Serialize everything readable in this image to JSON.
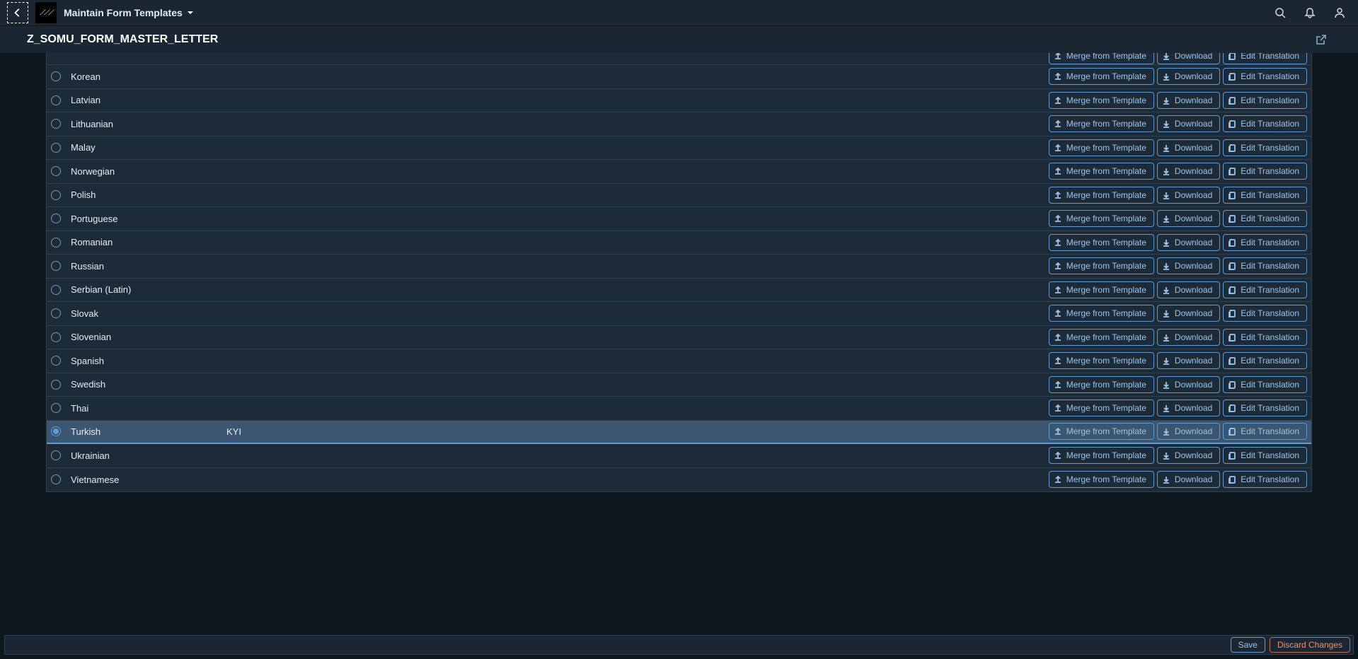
{
  "shell": {
    "app_title": "Maintain Form Templates"
  },
  "page": {
    "title": "Z_SOMU_FORM_MASTER_LETTER"
  },
  "buttons": {
    "merge": "Merge from Template",
    "download": "Download",
    "edit": "Edit Translation",
    "save": "Save",
    "discard": "Discard Changes"
  },
  "rows": [
    {
      "id": "partial-top",
      "name": "",
      "desc": "",
      "selected": false,
      "partial": true
    },
    {
      "id": "korean",
      "name": "Korean",
      "desc": "",
      "selected": false
    },
    {
      "id": "latvian",
      "name": "Latvian",
      "desc": "",
      "selected": false
    },
    {
      "id": "lithuanian",
      "name": "Lithuanian",
      "desc": "",
      "selected": false
    },
    {
      "id": "malay",
      "name": "Malay",
      "desc": "",
      "selected": false
    },
    {
      "id": "norwegian",
      "name": "Norwegian",
      "desc": "",
      "selected": false
    },
    {
      "id": "polish",
      "name": "Polish",
      "desc": "",
      "selected": false
    },
    {
      "id": "portuguese",
      "name": "Portuguese",
      "desc": "",
      "selected": false
    },
    {
      "id": "romanian",
      "name": "Romanian",
      "desc": "",
      "selected": false
    },
    {
      "id": "russian",
      "name": "Russian",
      "desc": "",
      "selected": false
    },
    {
      "id": "serbian",
      "name": "Serbian (Latin)",
      "desc": "",
      "selected": false
    },
    {
      "id": "slovak",
      "name": "Slovak",
      "desc": "",
      "selected": false
    },
    {
      "id": "slovenian",
      "name": "Slovenian",
      "desc": "",
      "selected": false
    },
    {
      "id": "spanish",
      "name": "Spanish",
      "desc": "",
      "selected": false
    },
    {
      "id": "swedish",
      "name": "Swedish",
      "desc": "",
      "selected": false
    },
    {
      "id": "thai",
      "name": "Thai",
      "desc": "",
      "selected": false
    },
    {
      "id": "turkish",
      "name": "Turkish",
      "desc": "KYI",
      "selected": true
    },
    {
      "id": "ukrainian",
      "name": "Ukrainian",
      "desc": "",
      "selected": false
    },
    {
      "id": "vietnamese",
      "name": "Vietnamese",
      "desc": "",
      "selected": false
    }
  ]
}
